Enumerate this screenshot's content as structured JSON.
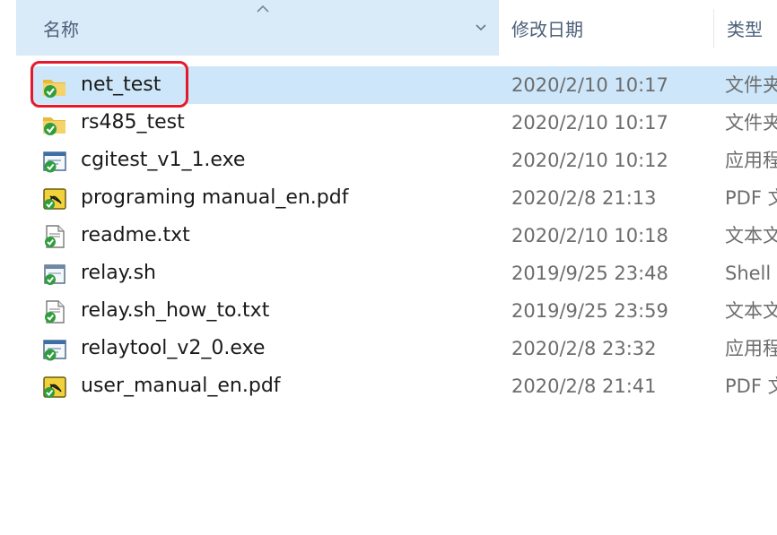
{
  "header": {
    "name_label": "名称",
    "date_label": "修改日期",
    "type_label": "类型"
  },
  "files": [
    {
      "name": "net_test",
      "date": "2020/2/10 10:17",
      "type": "文件夹",
      "icon": "folder-icon",
      "selected": true
    },
    {
      "name": "rs485_test",
      "date": "2020/2/10 10:17",
      "type": "文件夹",
      "icon": "folder-icon",
      "selected": false
    },
    {
      "name": "cgitest_v1_1.exe",
      "date": "2020/2/10 10:12",
      "type": "应用程序",
      "icon": "exe-icon",
      "selected": false
    },
    {
      "name": "programing manual_en.pdf",
      "date": "2020/2/8 21:13",
      "type": "PDF 文件",
      "icon": "pdf-icon",
      "selected": false
    },
    {
      "name": "readme.txt",
      "date": "2020/2/10 10:18",
      "type": "文本文档",
      "icon": "txt-icon",
      "selected": false
    },
    {
      "name": "relay.sh",
      "date": "2019/9/25 23:48",
      "type": "Shell",
      "icon": "script-icon",
      "selected": false
    },
    {
      "name": "relay.sh_how_to.txt",
      "date": "2019/9/25 23:59",
      "type": "文本文档",
      "icon": "txt-icon",
      "selected": false
    },
    {
      "name": "relaytool_v2_0.exe",
      "date": "2020/2/8 23:32",
      "type": "应用程序",
      "icon": "exe-icon",
      "selected": false
    },
    {
      "name": "user_manual_en.pdf",
      "date": "2020/2/8 21:41",
      "type": "PDF 文件",
      "icon": "pdf-icon",
      "selected": false
    }
  ],
  "colors": {
    "selection": "#cde6f9",
    "header_sorted": "#d9eaf9",
    "highlight_border": "#e5192b"
  }
}
